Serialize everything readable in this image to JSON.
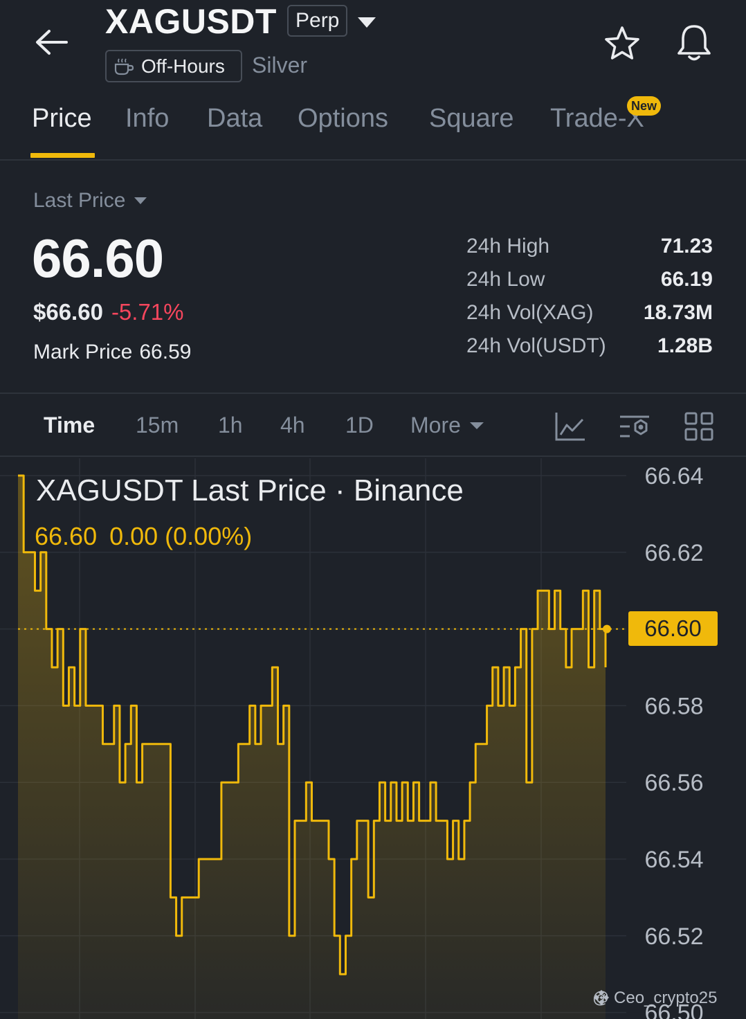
{
  "header": {
    "symbol": "XAGUSDT",
    "contract_type": "Perp",
    "status_badge": "Off-Hours",
    "asset_name": "Silver"
  },
  "tabs": [
    {
      "label": "Price",
      "active": true
    },
    {
      "label": "Info",
      "active": false
    },
    {
      "label": "Data",
      "active": false
    },
    {
      "label": "Options",
      "active": false
    },
    {
      "label": "Square",
      "active": false
    },
    {
      "label": "Trade-X",
      "active": false,
      "badge": "New"
    }
  ],
  "price": {
    "label": "Last Price",
    "last": "66.60",
    "usd": "$66.60",
    "change_pct": "-5.71%",
    "mark_label": "Mark Price",
    "mark_value": "66.59"
  },
  "stats": [
    {
      "label": "24h High",
      "value": "71.23"
    },
    {
      "label": "24h Low",
      "value": "66.19"
    },
    {
      "label": "24h Vol(XAG)",
      "value": "18.73M"
    },
    {
      "label": "24h Vol(USDT)",
      "value": "1.28B"
    }
  ],
  "intervals": {
    "items": [
      "Time",
      "15m",
      "1h",
      "4h",
      "1D"
    ],
    "active": "Time",
    "more_label": "More"
  },
  "tools": [
    "line-chart-icon",
    "indicator-settings-icon",
    "grid-layout-icon"
  ],
  "chart": {
    "title": "XAGUSDT Last Price · Binance",
    "legend_price": "66.60",
    "legend_change": "0.00 (0.00%)",
    "current_tag": "66.60",
    "watermark": "@ Ceo_crypto25"
  },
  "colors": {
    "background": "#1e2229",
    "accent": "#f0b90b",
    "negative": "#f6465d",
    "muted": "#848e9c"
  },
  "chart_data": {
    "type": "line",
    "title": "XAGUSDT Last Price · Binance",
    "ylim": [
      66.5,
      66.64
    ],
    "yticks": [
      "66.64",
      "66.62",
      "66.60",
      "66.58",
      "66.56",
      "66.54",
      "66.52",
      "66.50"
    ],
    "current_value": 66.6,
    "series": [
      {
        "values": [
          66.64,
          66.62,
          66.62,
          66.61,
          66.62,
          66.6,
          66.59,
          66.6,
          66.58,
          66.59,
          66.58,
          66.6,
          66.58,
          66.58,
          66.58,
          66.57,
          66.57,
          66.58,
          66.56,
          66.57,
          66.58,
          66.56,
          66.57,
          66.57,
          66.57,
          66.57,
          66.57,
          66.53,
          66.52,
          66.53,
          66.53,
          66.53,
          66.54,
          66.54,
          66.54,
          66.54,
          66.56,
          66.56,
          66.56,
          66.57,
          66.57,
          66.58,
          66.57,
          66.58,
          66.58,
          66.59,
          66.57,
          66.58,
          66.52,
          66.55,
          66.55,
          66.56,
          66.55,
          66.55,
          66.55,
          66.54,
          66.52,
          66.51,
          66.52,
          66.54,
          66.55,
          66.55,
          66.53,
          66.55,
          66.56,
          66.55,
          66.56,
          66.55,
          66.56,
          66.55,
          66.56,
          66.55,
          66.55,
          66.56,
          66.55,
          66.55,
          66.54,
          66.55,
          66.54,
          66.55,
          66.56,
          66.57,
          66.57,
          66.58,
          66.59,
          66.58,
          66.59,
          66.58,
          66.59,
          66.6,
          66.56,
          66.6,
          66.61,
          66.61,
          66.6,
          66.61,
          66.6,
          66.59,
          66.6,
          66.6,
          66.61,
          66.59,
          66.61,
          66.6,
          66.59
        ]
      }
    ]
  }
}
